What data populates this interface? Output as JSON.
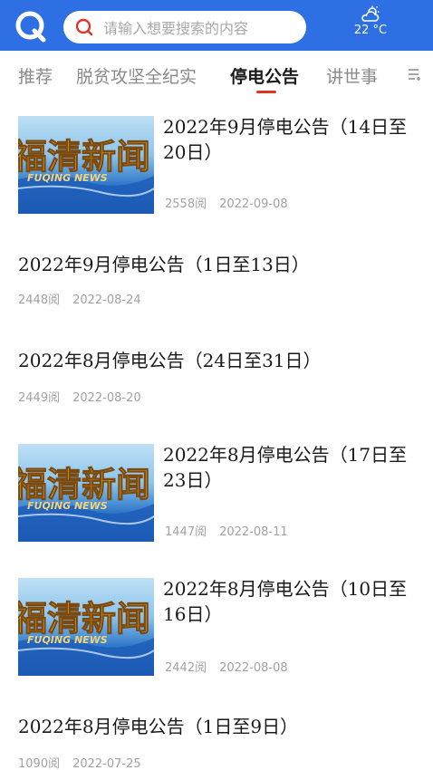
{
  "header": {
    "search_placeholder": "请输入想要搜索的内容",
    "weather_temp": "22 °C"
  },
  "tabs": [
    {
      "label": "推荐"
    },
    {
      "label": "脱贫攻坚全纪实"
    },
    {
      "label": "停电公告",
      "active": true
    },
    {
      "label": "讲世事"
    }
  ],
  "thumb_caption": {
    "main": "福清新闻",
    "sub": "FUQING NEWS"
  },
  "news": [
    {
      "title": "2022年9月停电公告（14日至20日）",
      "views": "2558阅",
      "date": "2022-09-08",
      "has_image": true
    },
    {
      "title": "2022年9月停电公告（1日至13日）",
      "views": "2448阅",
      "date": "2022-08-24",
      "has_image": false
    },
    {
      "title": "2022年8月停电公告（24日至31日）",
      "views": "2449阅",
      "date": "2022-08-20",
      "has_image": false
    },
    {
      "title": "2022年8月停电公告（17日至23日）",
      "views": "1447阅",
      "date": "2022-08-11",
      "has_image": true
    },
    {
      "title": "2022年8月停电公告（10日至16日）",
      "views": "2442阅",
      "date": "2022-08-08",
      "has_image": true
    },
    {
      "title": "2022年8月停电公告（1日至9日）",
      "views": "1090阅",
      "date": "2022-07-25",
      "has_image": false
    }
  ]
}
